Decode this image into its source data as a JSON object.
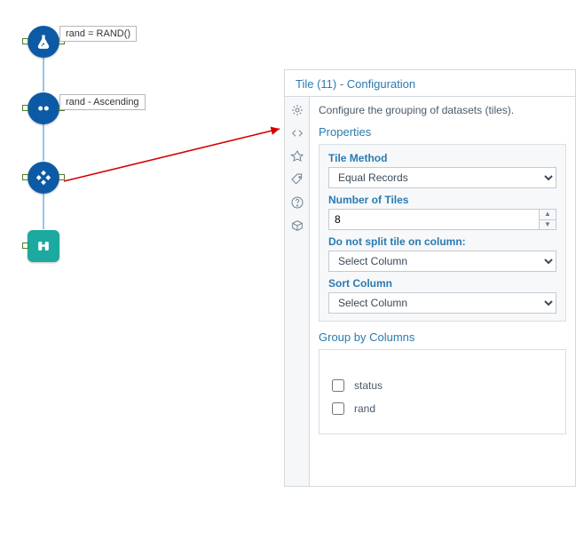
{
  "workflow": {
    "nodes": {
      "formula": {
        "label": "rand = RAND()"
      },
      "sort": {
        "label": "rand - Ascending"
      },
      "tile": {
        "label": ""
      },
      "browse": {
        "label": ""
      }
    }
  },
  "panel": {
    "title": "Tile (11) - Configuration",
    "description": "Configure the grouping of datasets (tiles).",
    "properties_title": "Properties",
    "tile_method": {
      "label": "Tile Method",
      "value": "Equal Records"
    },
    "num_tiles": {
      "label": "Number of Tiles",
      "value": "8"
    },
    "no_split": {
      "label": "Do not split tile on column:",
      "value": "Select Column"
    },
    "sort_col": {
      "label": "Sort Column",
      "value": "Select Column"
    },
    "group_by": {
      "title": "Group by Columns",
      "options": [
        {
          "label": "status",
          "checked": false
        },
        {
          "label": "rand",
          "checked": false
        }
      ]
    }
  }
}
